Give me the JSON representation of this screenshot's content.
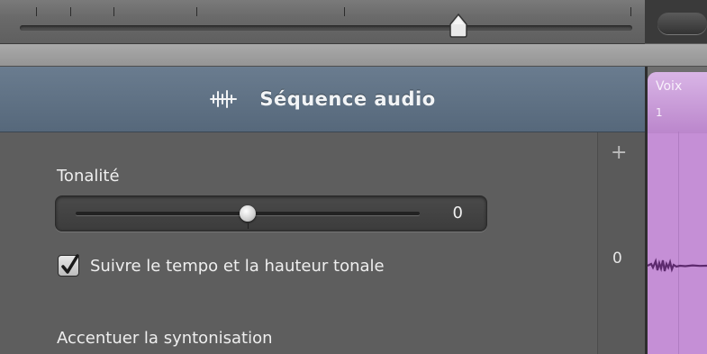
{
  "inspector": {
    "title": "Séquence audio",
    "header_icon": "waveform-icon",
    "pitch": {
      "label": "Tonalité",
      "value": "0",
      "level_fraction": 0.5
    },
    "follow_tempo": {
      "label": "Suivre le tempo et la hauteur tonale",
      "checked": true
    },
    "tuning_label": "Accentuer la syntonisation",
    "side_column": {
      "plus": "+",
      "zero": "0"
    }
  },
  "region": {
    "name": "Voix",
    "number": "1",
    "color": "#c58fd6"
  },
  "top_slider": {
    "level_fraction": 0.73
  },
  "colors": {
    "header": "#5f7185",
    "accent": "#2e5fd0"
  }
}
